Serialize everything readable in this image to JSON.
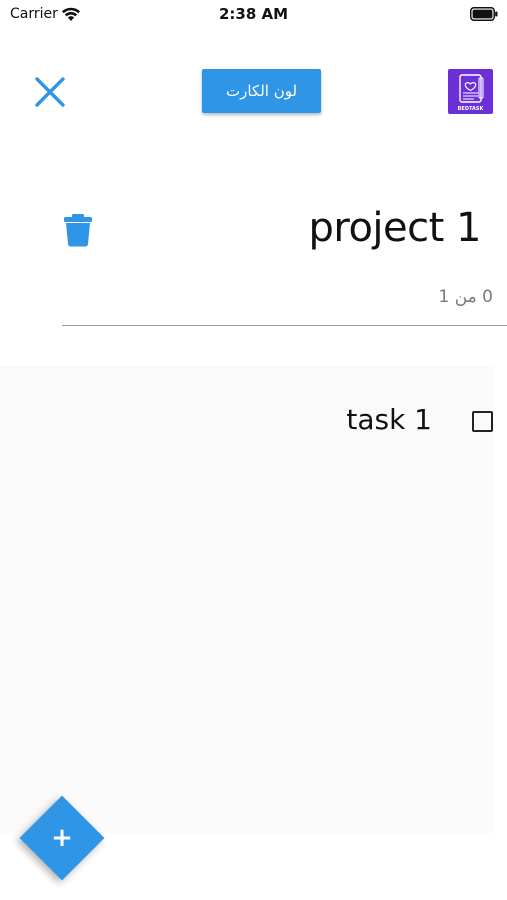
{
  "status_bar": {
    "carrier": "Carrier",
    "time": "2:38 AM",
    "wifi_icon": "wifi-icon",
    "battery_icon": "battery-icon"
  },
  "header": {
    "close_icon": "close-icon",
    "color_button_label": "لون الكارت",
    "logo_text": "BEDTASK"
  },
  "project": {
    "title": "project 1",
    "progress_text": "0 من 1",
    "delete_icon": "trash-icon"
  },
  "tasks": [
    {
      "label": "task 1",
      "checked": false
    }
  ],
  "fab": {
    "label": "+",
    "icon": "plus-icon"
  },
  "colors": {
    "accent": "#2f95e6",
    "logo_bg": "#6d2fd8",
    "card_bg": "#fafafa",
    "muted_text": "#7a7a7a"
  }
}
